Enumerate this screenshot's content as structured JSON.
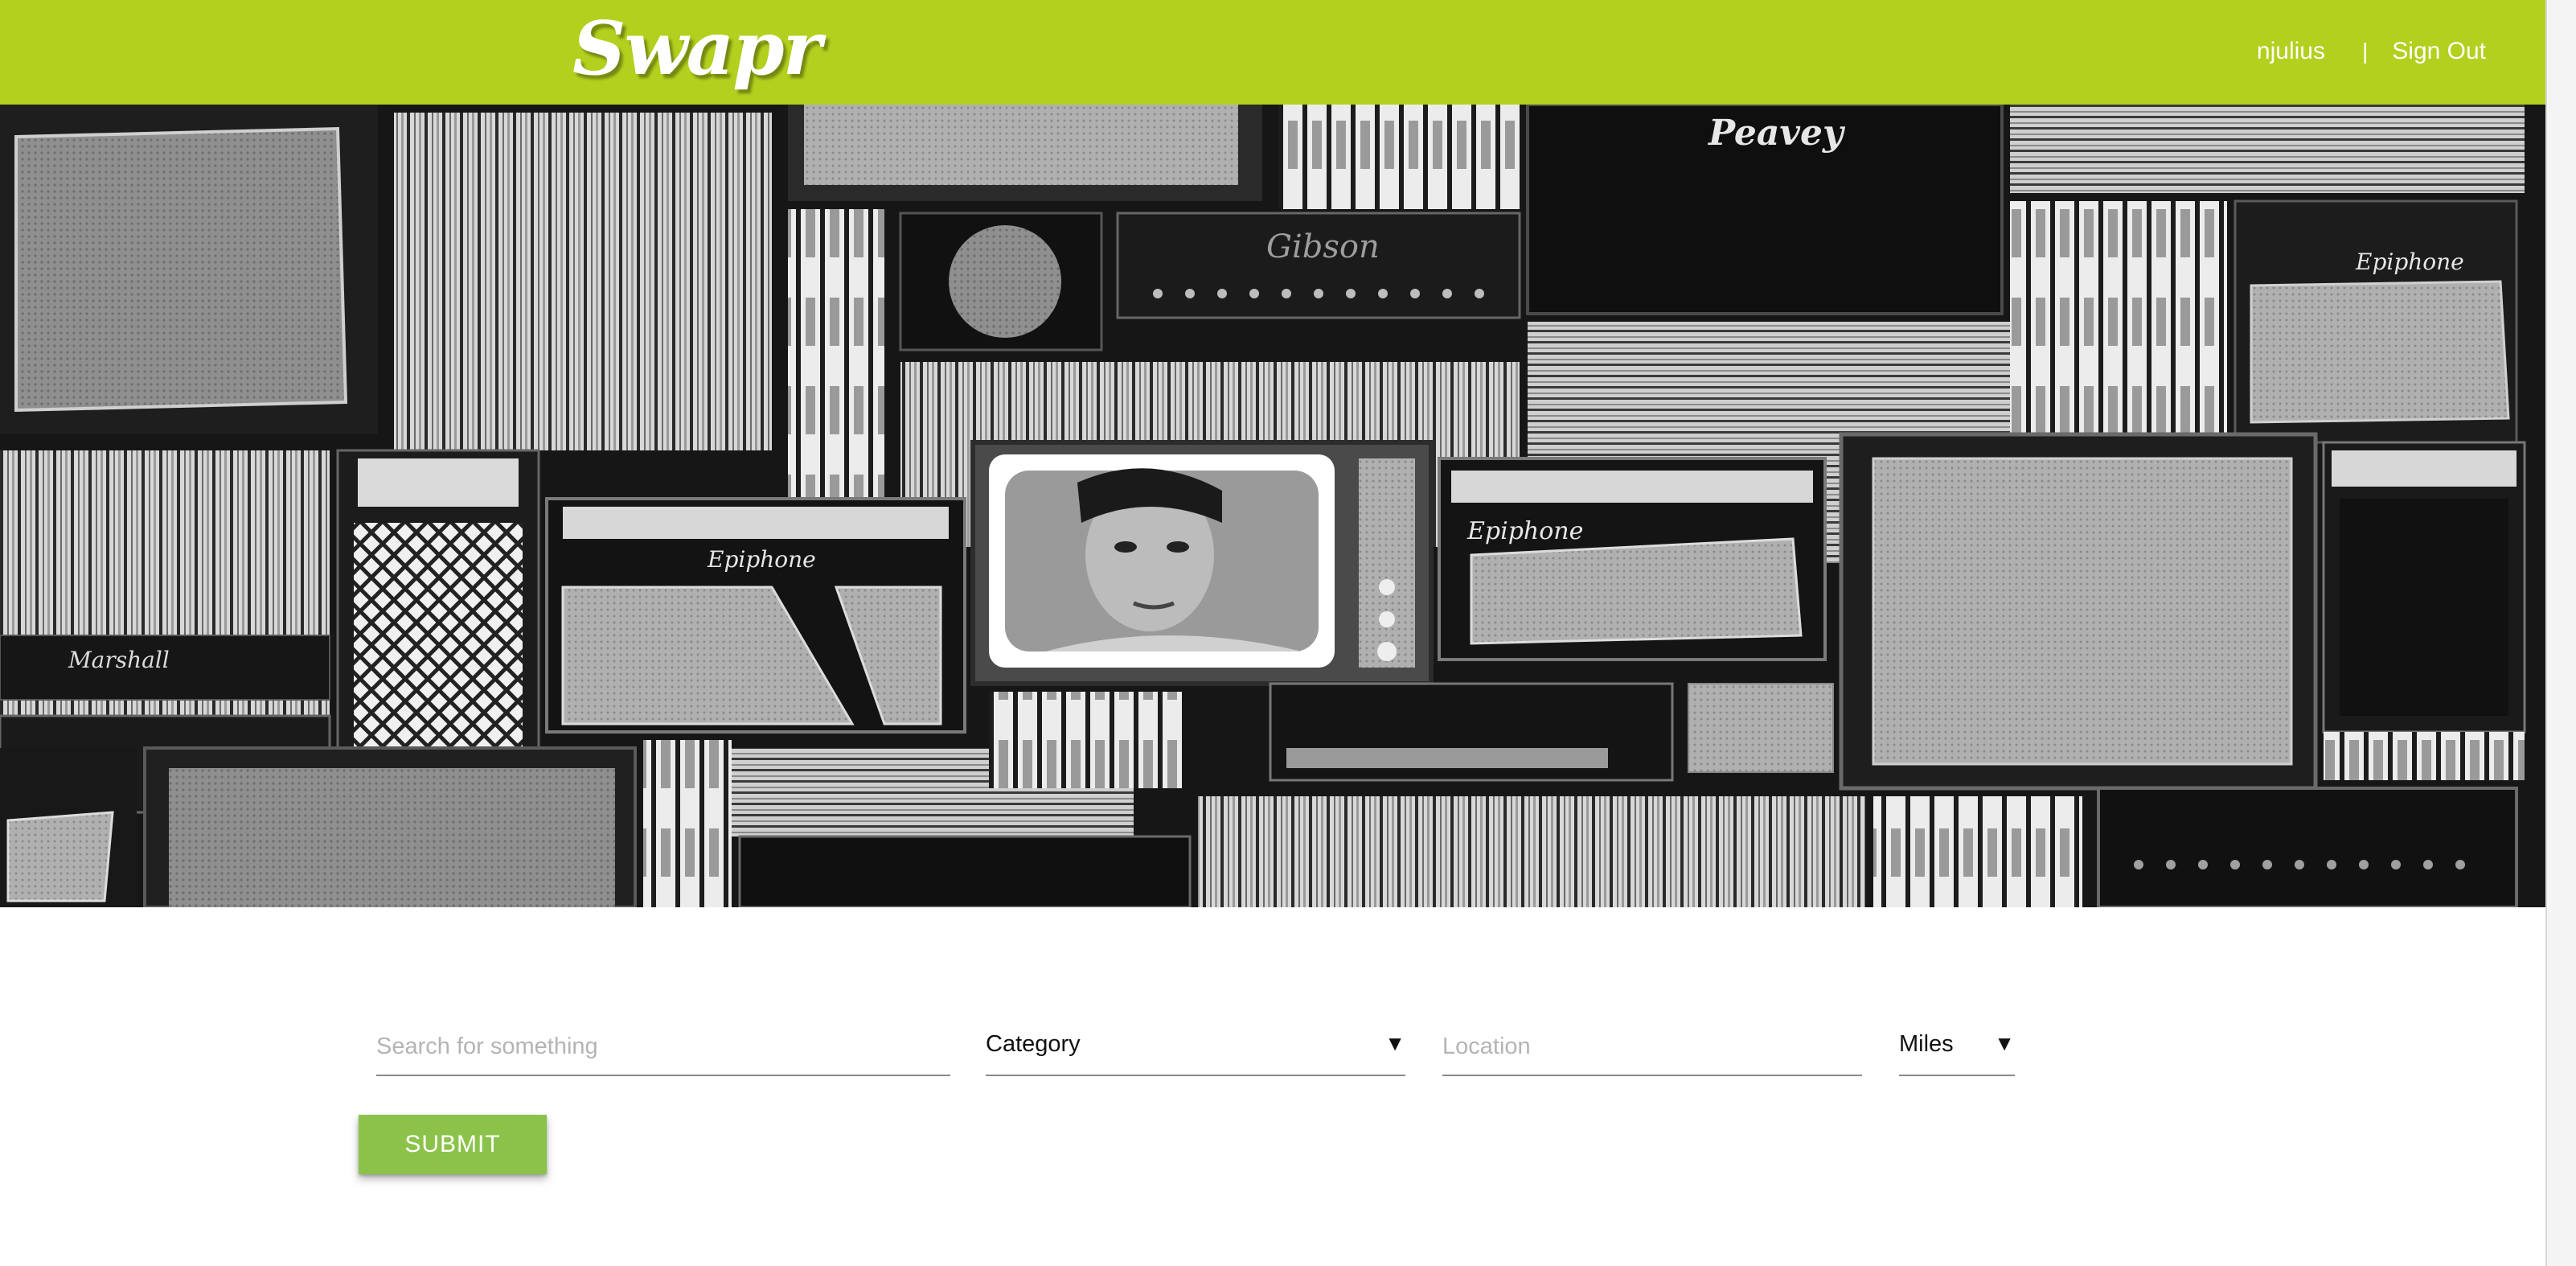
{
  "app": {
    "name": "Swapr"
  },
  "header": {
    "logo_text": "Swapr",
    "username": "njulius",
    "separator": "|",
    "signout_label": "Sign Out",
    "brand_color": "#b2d01d"
  },
  "hero": {
    "image_subject": "black-and-white wall of guitar amplifiers, cassette tapes and a vintage TV showing a portrait",
    "icon": "hero-image"
  },
  "search": {
    "query_placeholder": "Search for something",
    "query_value": "",
    "category_selected": "Category",
    "location_placeholder": "Location",
    "location_value": "",
    "distance_selected": "Miles",
    "submit_label": "SUBMIT",
    "submit_color": "#8bc34a",
    "caret_icon": "triangle-down-icon"
  }
}
